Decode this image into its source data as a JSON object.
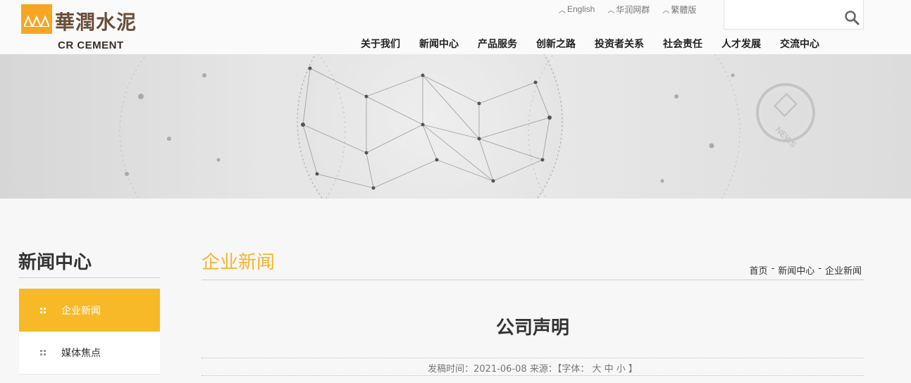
{
  "header": {
    "logo_cn": "華潤水泥",
    "logo_en": "CR CEMENT",
    "top_links": [
      {
        "label": "English"
      },
      {
        "label": "华润网群"
      },
      {
        "label": "繁體版"
      }
    ],
    "search": {
      "placeholder": ""
    }
  },
  "nav": {
    "items": [
      {
        "label": "关于我们"
      },
      {
        "label": "新闻中心"
      },
      {
        "label": "产品服务"
      },
      {
        "label": "创新之路"
      },
      {
        "label": "投资者关系"
      },
      {
        "label": "社会责任"
      },
      {
        "label": "人才发展"
      },
      {
        "label": "交流中心"
      }
    ]
  },
  "banner": {
    "badge": "NEWS"
  },
  "sidebar": {
    "title": "新闻中心",
    "items": [
      {
        "label": "企业新闻",
        "active": true
      },
      {
        "label": "媒体焦点",
        "active": false
      }
    ]
  },
  "main": {
    "section_title": "企业新闻",
    "breadcrumb": [
      "首页",
      "新闻中心",
      "企业新闻"
    ],
    "breadcrumb_sep": "-",
    "article_title": "公司声明",
    "meta": "发稿时间：2021-06-08 来源：【字体： 大 中 小 】"
  },
  "colors": {
    "accent": "#f7b928",
    "logo_orange": "#f6a623",
    "logo_brown": "#6b4e3a"
  }
}
